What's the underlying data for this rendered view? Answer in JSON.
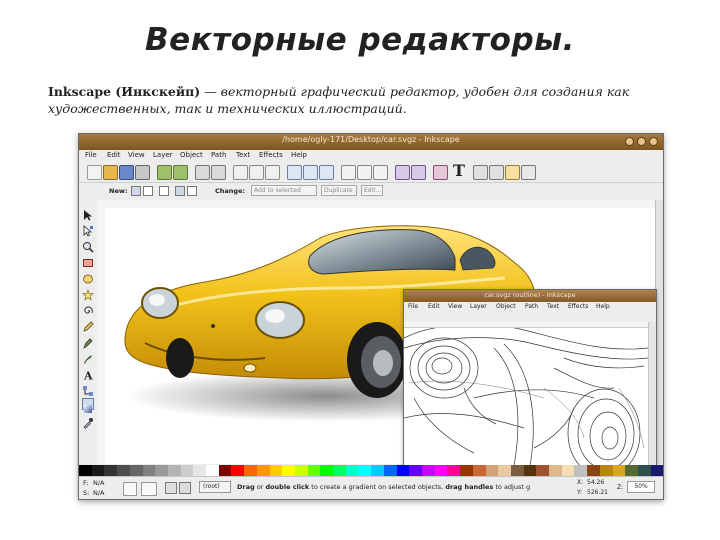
{
  "slide": {
    "title": "Векторные редакторы.",
    "desc_bold": "Inkscape (Инкскейп)",
    "desc_rest": " — векторный графический редактор, удобен для создания как художественных, так и технических иллюстраций."
  },
  "window": {
    "title": "/home/ogly-171/Desktop/car.svgz - Inkscape",
    "menu": [
      "File",
      "Edit",
      "View",
      "Layer",
      "Object",
      "Path",
      "Text",
      "Effects",
      "Help"
    ]
  },
  "tool_controls": {
    "new_label": "New:",
    "change_label": "Change:",
    "field1": "Add to selected",
    "field2": "Duplicate",
    "field3": "Edit..."
  },
  "inner_window": {
    "title": "car.svgz (outline) - Inkscape",
    "menu": [
      "File",
      "Edit",
      "View",
      "Layer",
      "Object",
      "Path",
      "Text",
      "Effects",
      "Help"
    ]
  },
  "status": {
    "fill_label": "F:",
    "stroke_label": "S:",
    "fill_value": "N/A",
    "stroke_value": "N/A",
    "layer": "(root)",
    "message_b1": "Drag",
    "message_t1": " or ",
    "message_b2": "double click",
    "message_t2": " to create a gradient on selected objects, ",
    "message_b3": "drag handles",
    "message_t3": " to adjust g",
    "x_label": "X:",
    "x": "54.26",
    "y_label": "Y:",
    "y": "526.21",
    "zoom_label": "Z:",
    "zoom": "50%"
  },
  "colors": {
    "accent_titlebar": "#8e6430",
    "car_body": "#f2c21a",
    "palette": [
      "#000000",
      "#1a1a1a",
      "#333333",
      "#4d4d4d",
      "#666666",
      "#808080",
      "#999999",
      "#b3b3b3",
      "#cccccc",
      "#e6e6e6",
      "#ffffff",
      "#800000",
      "#ff0000",
      "#ff6600",
      "#ff9900",
      "#ffcc00",
      "#ffff00",
      "#ccff00",
      "#66ff00",
      "#00ff00",
      "#00ff66",
      "#00ffcc",
      "#00ffff",
      "#00ccff",
      "#0066ff",
      "#0000ff",
      "#6600ff",
      "#cc00ff",
      "#ff00ff",
      "#ff0099",
      "#993300",
      "#cc6633",
      "#d4a373",
      "#e8c9a0",
      "#7a5c3e",
      "#553311",
      "#a0522d",
      "#deb887",
      "#f5deb3",
      "#c0c0c0",
      "#8b4513",
      "#b8860b",
      "#daa520",
      "#556b2f",
      "#2f4f4f",
      "#191970"
    ]
  }
}
